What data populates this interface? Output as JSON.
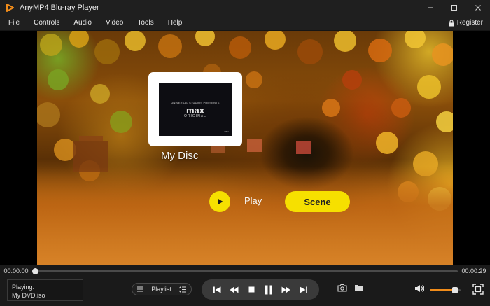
{
  "window": {
    "title": "AnyMP4 Blu-ray Player",
    "accent": "#f08c1a",
    "controls": [
      "minimize-icon",
      "maximize-icon",
      "close-icon"
    ]
  },
  "menu": {
    "items": [
      "File",
      "Controls",
      "Audio",
      "Video",
      "Tools",
      "Help"
    ],
    "register_label": "Register"
  },
  "disc_menu": {
    "stamp_small_text": "UNIVERSAL STUDIOS PRESENTS",
    "stamp_brand": "max",
    "stamp_sub": "ORIGINAL",
    "stamp_corner": "HBO",
    "disc_label": "My Disc",
    "play_label": "Play",
    "scene_label": "Scene",
    "highlight_color": "#f6e000"
  },
  "playback": {
    "elapsed": "00:00:00",
    "duration": "00:00:29",
    "progress_fraction": 0.0
  },
  "status": {
    "line1": "Playing:",
    "line2": "My DVD.iso"
  },
  "playlist": {
    "label": "Playlist"
  },
  "transport": {
    "buttons": [
      "skip-back-icon",
      "rewind-icon",
      "stop-icon",
      "pause-icon",
      "fast-forward-icon",
      "skip-forward-icon"
    ]
  },
  "volume": {
    "level_fraction": 0.82
  }
}
